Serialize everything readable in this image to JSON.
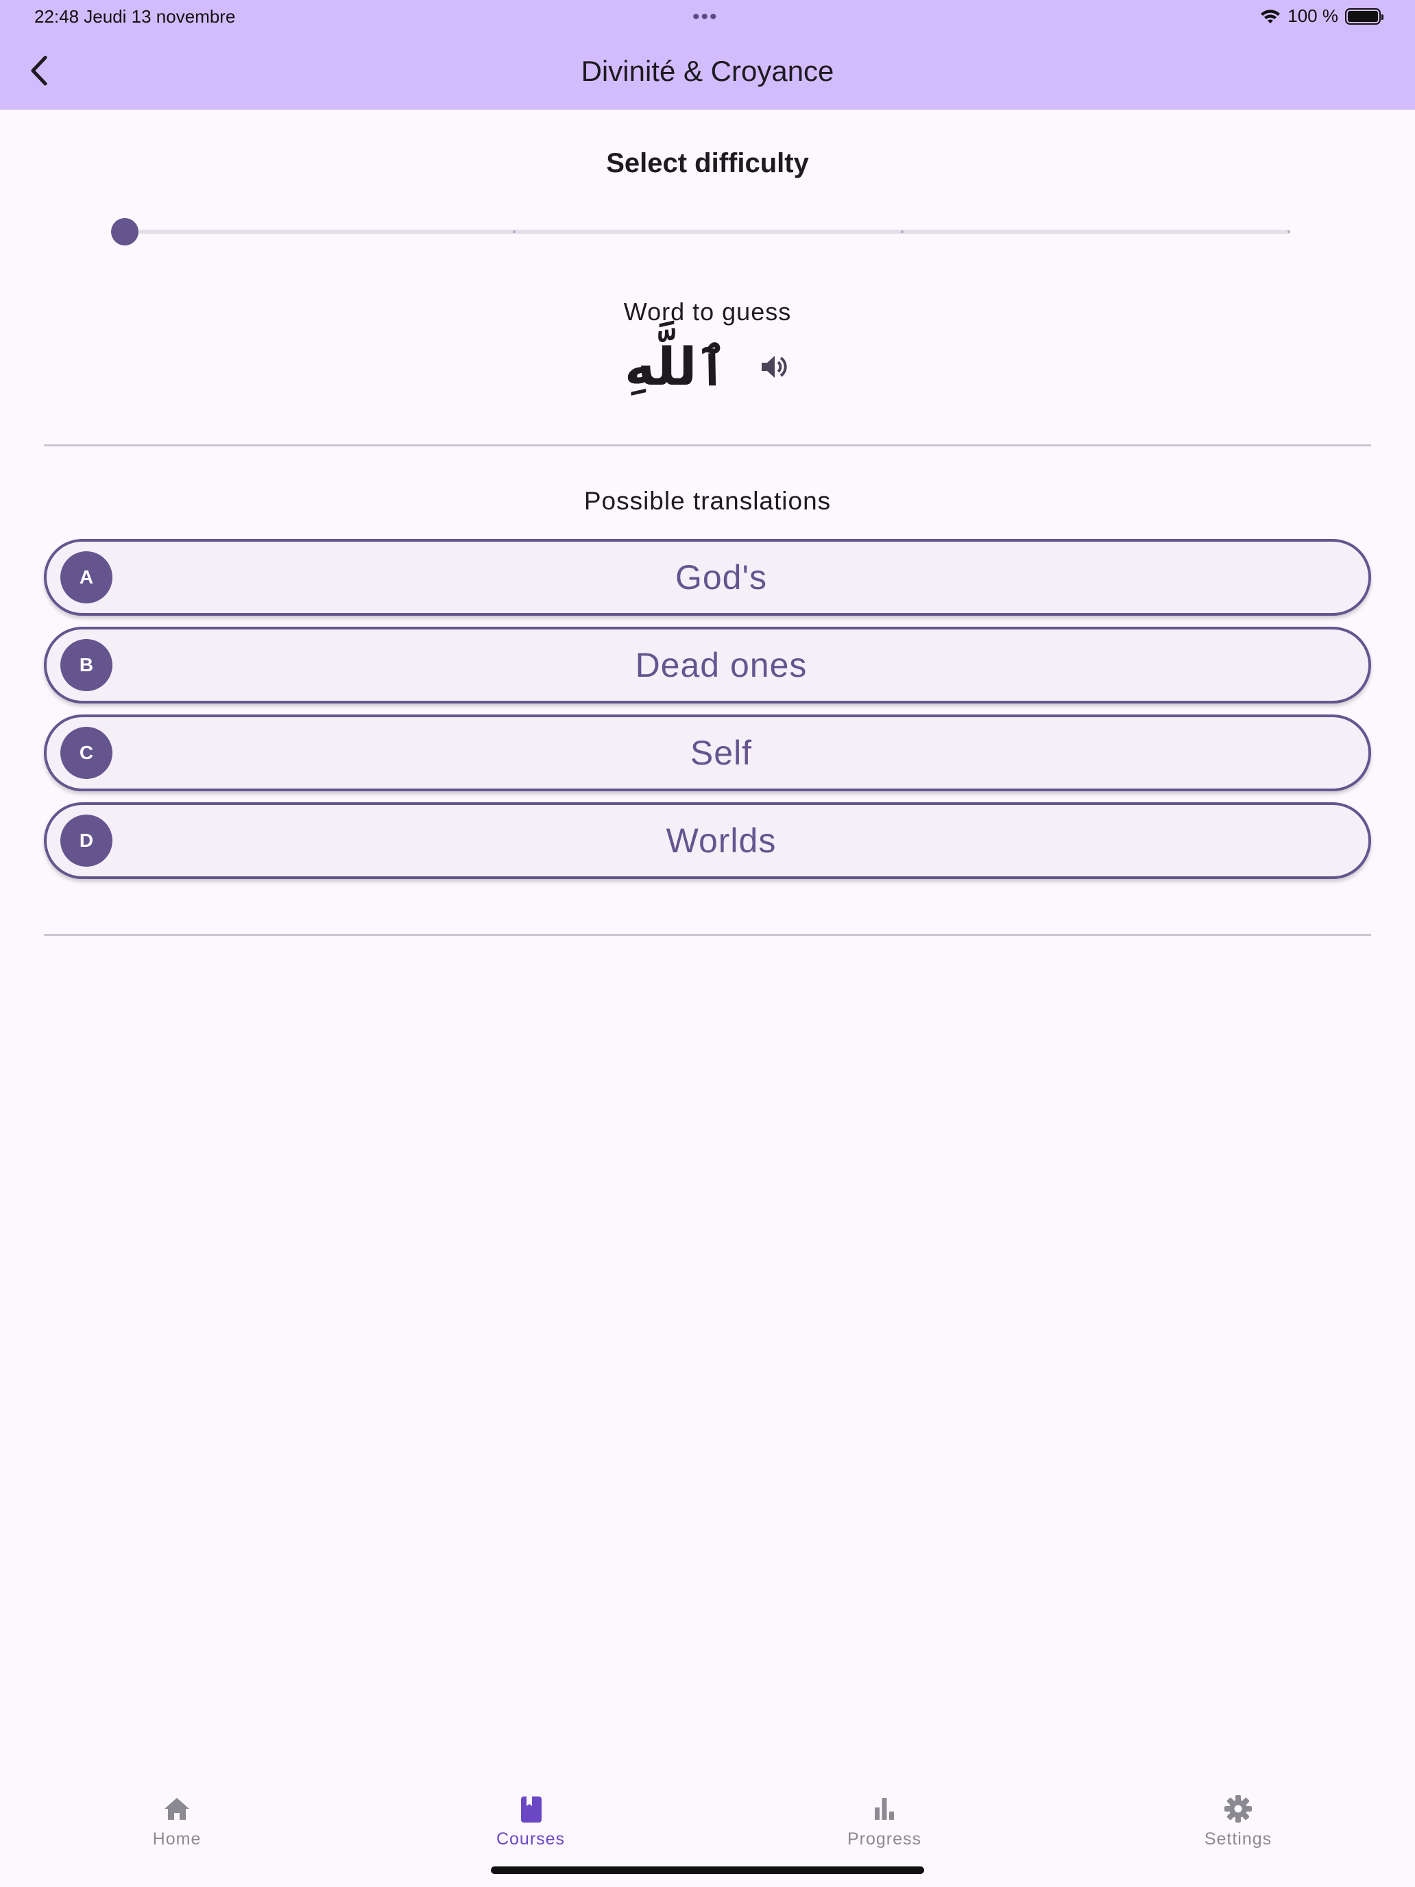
{
  "status_bar": {
    "time_date": "22:48   Jeudi 13 novembre",
    "dots": "•••",
    "battery": "100 %"
  },
  "app_bar": {
    "title": "Divinité & Croyance",
    "back_icon": "chevron-left-icon"
  },
  "difficulty": {
    "heading": "Select difficulty",
    "level": 0,
    "steps": 4
  },
  "word": {
    "heading": "Word to guess",
    "arabic": "ٱللَّهِ",
    "audio_icon": "speaker-icon"
  },
  "translations": {
    "heading": "Possible translations",
    "options": [
      {
        "letter": "A",
        "label": "God's"
      },
      {
        "letter": "B",
        "label": "Dead ones"
      },
      {
        "letter": "C",
        "label": "Self"
      },
      {
        "letter": "D",
        "label": "Worlds"
      }
    ]
  },
  "bottom_nav": {
    "items": [
      {
        "label": "Home",
        "icon": "home-icon",
        "active": false
      },
      {
        "label": "Courses",
        "icon": "book-icon",
        "active": true
      },
      {
        "label": "Progress",
        "icon": "bar-chart-icon",
        "active": false
      },
      {
        "label": "Settings",
        "icon": "gear-icon",
        "active": false
      }
    ]
  },
  "colors": {
    "app_bar": "#d3bcfd",
    "background": "#fdf7fe",
    "accent": "#65558f",
    "nav_active": "#6a48c4",
    "nav_inactive": "#8c8a91"
  }
}
